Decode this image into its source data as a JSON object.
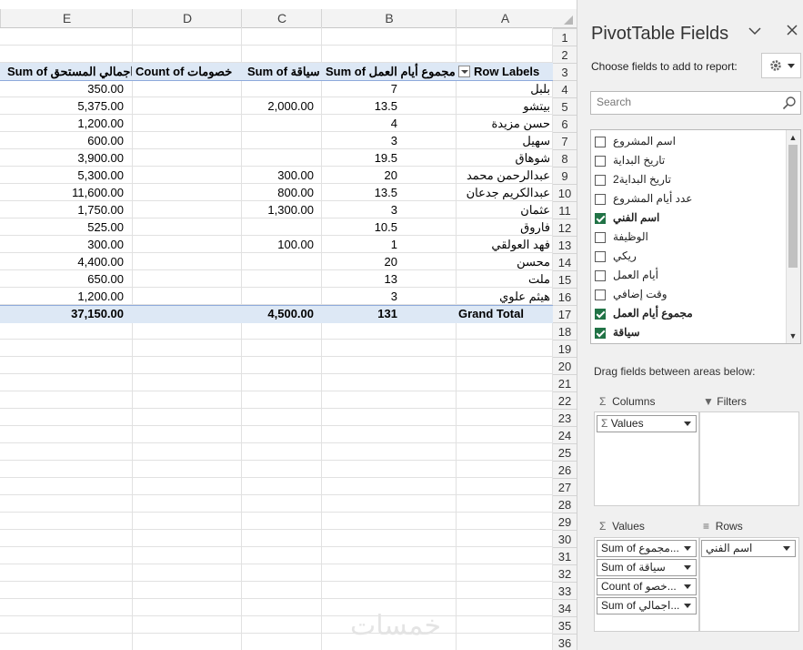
{
  "sheet": {
    "columns": [
      "E",
      "D",
      "C",
      "B",
      "A"
    ],
    "row_numbers": [
      "1",
      "2",
      "3",
      "4",
      "5",
      "6",
      "7",
      "8",
      "9",
      "10",
      "11",
      "12",
      "13",
      "14",
      "15",
      "16",
      "17",
      "18",
      "19",
      "20",
      "21",
      "22",
      "23",
      "24",
      "25",
      "26",
      "27",
      "28",
      "29",
      "30",
      "31",
      "32",
      "33",
      "34",
      "35",
      "36"
    ],
    "headers": {
      "a": "Row Labels",
      "b": "Sum of مجموع أيام العمل",
      "c": "Sum of سياقة",
      "d": "Count of خصومات",
      "e": "Sum of اجمالي المستحق"
    },
    "rows": [
      {
        "a": "بلبل",
        "b": "7",
        "c": "",
        "e": "350.00"
      },
      {
        "a": "بيتشو",
        "b": "13.5",
        "c": "2,000.00",
        "e": "5,375.00"
      },
      {
        "a": "حسن مزيدة",
        "b": "4",
        "c": "",
        "e": "1,200.00"
      },
      {
        "a": "سهيل",
        "b": "3",
        "c": "",
        "e": "600.00"
      },
      {
        "a": "شوهاق",
        "b": "19.5",
        "c": "",
        "e": "3,900.00"
      },
      {
        "a": "عبدالرحمن محمد",
        "b": "20",
        "c": "300.00",
        "e": "5,300.00"
      },
      {
        "a": "عبدالكريم جدعان",
        "b": "13.5",
        "c": "800.00",
        "e": "11,600.00"
      },
      {
        "a": "عثمان",
        "b": "3",
        "c": "1,300.00",
        "e": "1,750.00"
      },
      {
        "a": "فاروق",
        "b": "10.5",
        "c": "",
        "e": "525.00"
      },
      {
        "a": "فهد العولقي",
        "b": "1",
        "c": "100.00",
        "e": "300.00"
      },
      {
        "a": "محسن",
        "b": "20",
        "c": "",
        "e": "4,400.00"
      },
      {
        "a": "ملت",
        "b": "13",
        "c": "",
        "e": "650.00"
      },
      {
        "a": "هيثم علوي",
        "b": "3",
        "c": "",
        "e": "1,200.00"
      }
    ],
    "total": {
      "a": "Grand Total",
      "b": "131",
      "c": "4,500.00",
      "e": "37,150.00"
    },
    "watermark": "خمسات"
  },
  "pane": {
    "title": "PivotTable Fields",
    "choose_label": "Choose fields to add to report:",
    "search_placeholder": "Search",
    "fields": [
      {
        "label": "اسم المشروع",
        "checked": false
      },
      {
        "label": "تاريخ البداية",
        "checked": false
      },
      {
        "label": "تاريخ البداية2",
        "checked": false
      },
      {
        "label": "عدد أيام المشروع",
        "checked": false
      },
      {
        "label": "اسم الفني",
        "checked": true
      },
      {
        "label": "الوظيفة",
        "checked": false
      },
      {
        "label": "ريكي",
        "checked": false
      },
      {
        "label": "أيام العمل",
        "checked": false
      },
      {
        "label": "وقت إضافي",
        "checked": false
      },
      {
        "label": "مجموع أيام العمل",
        "checked": true
      },
      {
        "label": "سياقة",
        "checked": true
      }
    ],
    "drag_label": "Drag fields between areas below:",
    "areas": {
      "filters": "Filters",
      "columns": "Columns",
      "rows": "Rows",
      "values": "Values"
    },
    "columns_items": [
      "Values"
    ],
    "rows_items": [
      "اسم الفني"
    ],
    "values_items": [
      "Sum of مجموع...",
      "Sum of سياقة",
      "Count of خصو...",
      "Sum of اجمالي..."
    ],
    "icons": [
      "chevron-down-icon",
      "close-icon",
      "gear-icon",
      "search-icon",
      "sigma-icon",
      "filter-icon",
      "rows-icon"
    ]
  }
}
